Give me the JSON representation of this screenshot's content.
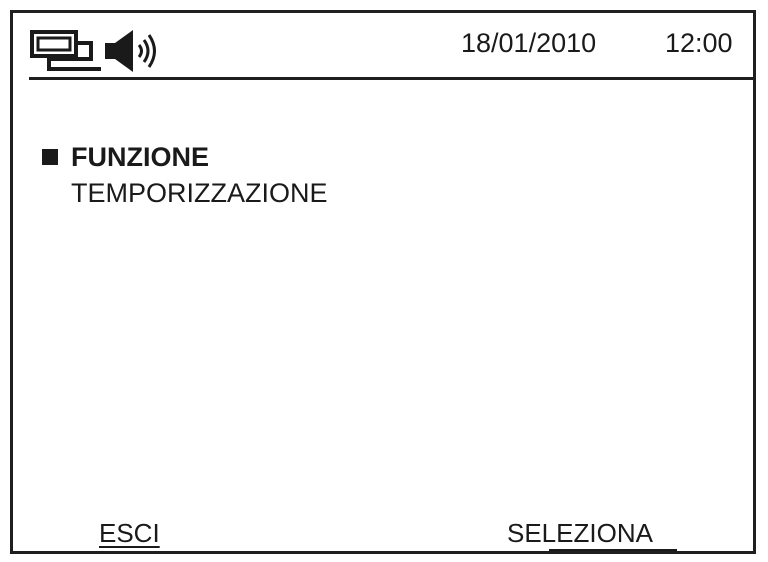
{
  "status_bar": {
    "network_icon": "network-computer-icon",
    "speaker_icon": "speaker-icon",
    "date": "18/01/2010",
    "time": "12:00"
  },
  "menu": {
    "items": [
      {
        "label": "FUNZIONE",
        "selected": true
      },
      {
        "label": "TEMPORIZZAZIONE",
        "selected": false
      }
    ]
  },
  "softkeys": {
    "left_label": "ESCI",
    "right_label": "SELEZIONA"
  },
  "colors": {
    "background": "#ffffff",
    "foreground": "#1a1a1a"
  }
}
